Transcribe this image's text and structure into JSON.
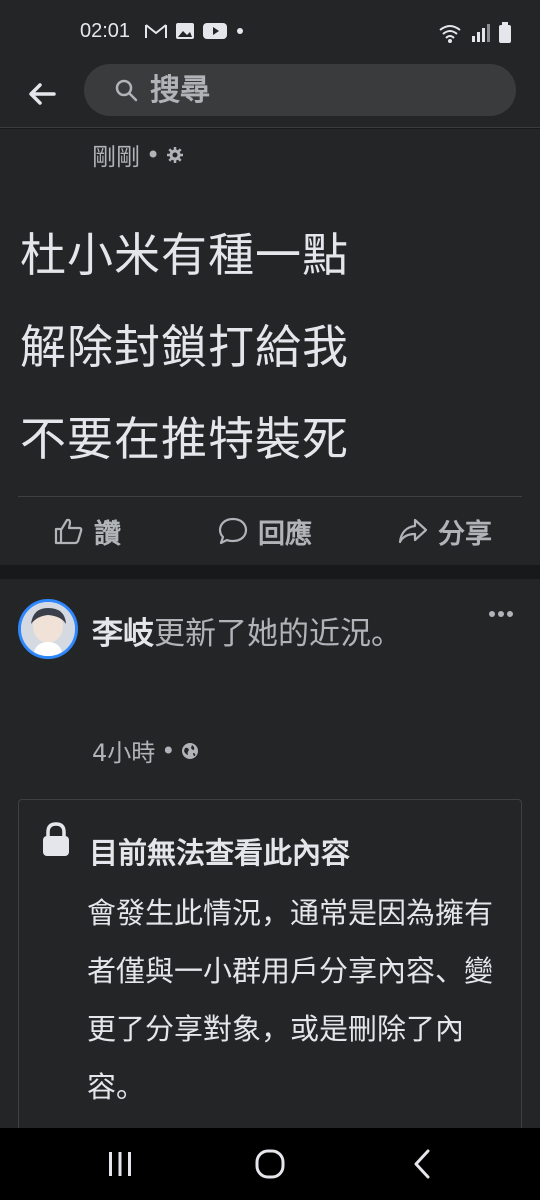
{
  "status_bar": {
    "time": "02:01"
  },
  "app_bar": {
    "search_placeholder": "搜尋"
  },
  "post1": {
    "time": "剛剛",
    "separator": "•",
    "lines": [
      "杜小米有種一點",
      "解除封鎖打給我",
      "不要在推特裝死"
    ],
    "actions": {
      "like": "讚",
      "comment": "回應",
      "share": "分享"
    }
  },
  "post2": {
    "author": "李岐",
    "action_text": "更新了她的近況。",
    "time": "4小時",
    "separator": "•",
    "notice": {
      "title": "目前無法查看此內容",
      "body": "會發生此情況，通常是因為擁有者僅與一小群用戶分享內容、變更了分享對象，或是刪除了內容。"
    }
  },
  "colors": {
    "background": "#18191a",
    "surface": "#242526",
    "text_primary": "#e4e6eb",
    "text_secondary": "#b0b3b8",
    "accent": "#2d88ff"
  },
  "icons": [
    "gmail-icon",
    "gallery-icon",
    "youtube-icon",
    "dot-icon",
    "wifi-icon",
    "signal-icon",
    "battery-icon",
    "back-arrow-icon",
    "search-icon",
    "gear-icon",
    "like-icon",
    "comment-icon",
    "share-icon",
    "more-icon",
    "globe-icon",
    "lock-icon",
    "recents-icon",
    "home-icon",
    "back-icon"
  ]
}
